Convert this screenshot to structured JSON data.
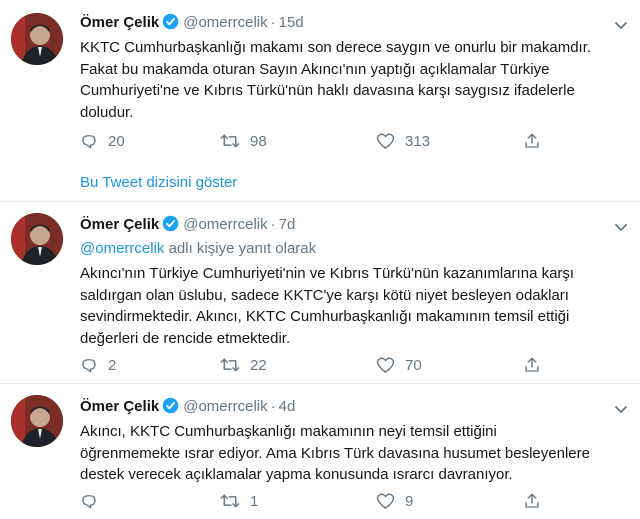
{
  "tweets": [
    {
      "name": "Ömer Çelik",
      "handle": "@omerrcelik",
      "separator": "·",
      "time": "15d",
      "reply_prefix": "",
      "reply_suffix": "",
      "text": "KKTC Cumhurbaşkanlığı makamı son derece saygın ve onurlu bir makamdır.\nFakat bu makamda oturan Sayın Akıncı'nın yaptığı açıklamalar Türkiye\nCumhuriyeti'ne ve Kıbrıs Türkü'nün haklı davasına karşı saygısız ifadelerle\ndoludur.",
      "replies": "20",
      "retweets": "98",
      "likes": "313"
    },
    {
      "name": "Ömer Çelik",
      "handle": "@omerrcelik",
      "separator": "·",
      "time": "7d",
      "reply_prefix": "@omerrcelik",
      "reply_suffix": " adlı kişiye yanıt olarak",
      "text": "Akıncı'nın Türkiye Cumhuriyeti'nin ve Kıbrıs Türkü'nün kazanımlarına karşı\nsaldırgan olan üslubu, sadece KKTC'ye karşı kötü niyet besleyen odakları\nsevindirmektedir. Akıncı, KKTC Cumhurbaşkanlığı makamının temsil ettiği\ndeğerleri de rencide etmektedir.",
      "replies": "2",
      "retweets": "22",
      "likes": "70"
    },
    {
      "name": "Ömer Çelik",
      "handle": "@omerrcelik",
      "separator": "·",
      "time": "4d",
      "reply_prefix": "",
      "reply_suffix": "",
      "text": "Akıncı, KKTC Cumhurbaşkanlığı makamının neyi temsil ettiğini\nöğrenmemekte ısrar ediyor. Ama Kıbrıs Türk davasına husumet besleyenlere\ndestek verecek açıklamalar yapma konusunda ısrarcı davranıyor.",
      "replies": "",
      "retweets": "1",
      "likes": "9"
    }
  ],
  "thread_link": "Bu Tweet dizisini göster",
  "colors": {
    "accent": "#1b95e0",
    "muted": "#657786",
    "text": "#14171a",
    "divider": "#e6ecf0"
  },
  "icons": [
    "verified-badge-icon",
    "chevron-down-icon",
    "reply-icon",
    "retweet-icon",
    "like-icon",
    "share-icon"
  ]
}
